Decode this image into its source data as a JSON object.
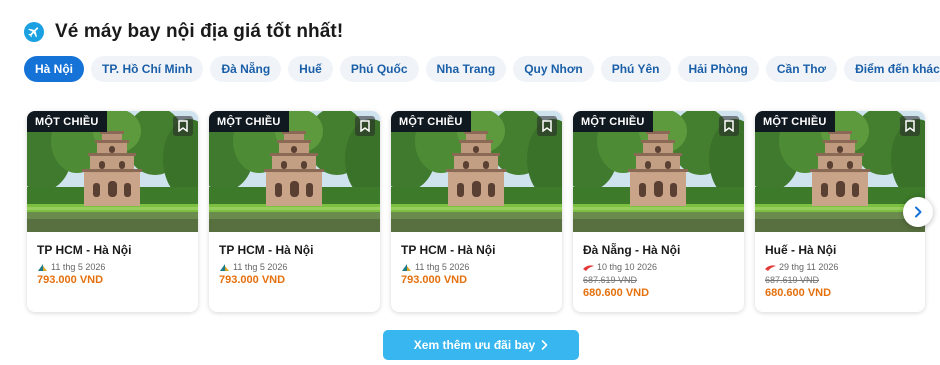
{
  "section": {
    "title": "Vé máy bay nội địa giá tốt nhất!"
  },
  "tabs": [
    "Hà Nội",
    "TP. Hồ Chí Minh",
    "Đà Nẵng",
    "Huế",
    "Phú Quốc",
    "Nha Trang",
    "Quy Nhơn",
    "Phú Yên",
    "Hải Phòng",
    "Cần Thơ",
    "Điểm đến khác"
  ],
  "active_tab": "Hà Nội",
  "cards": [
    {
      "badge": "MỘT CHIỀU",
      "route": "TP HCM - Hà Nội",
      "date": "11 thg 5 2026",
      "airline_icon": "vietnam-airlines-icon",
      "old_price": "",
      "price": "793.000 VND"
    },
    {
      "badge": "MỘT CHIỀU",
      "route": "TP HCM - Hà Nội",
      "date": "11 thg 5 2026",
      "airline_icon": "vietnam-airlines-icon",
      "old_price": "",
      "price": "793.000 VND"
    },
    {
      "badge": "MỘT CHIỀU",
      "route": "TP HCM - Hà Nội",
      "date": "11 thg 5 2026",
      "airline_icon": "vietnam-airlines-icon",
      "old_price": "",
      "price": "793.000 VND"
    },
    {
      "badge": "MỘT CHIỀU",
      "route": "Đà Nẵng - Hà Nội",
      "date": "10 thg 10 2026",
      "airline_icon": "vietjet-icon",
      "old_price": "687.619 VND",
      "price": "680.600 VND"
    },
    {
      "badge": "MỘT CHIỀU",
      "route": "Huế - Hà Nội",
      "date": "29 thg 11 2026",
      "airline_icon": "vietjet-icon",
      "old_price": "687.619 VND",
      "price": "680.600 VND"
    }
  ],
  "more_button": {
    "label": "Xem thêm ưu đãi bay"
  },
  "icons": {
    "header": "plane-icon",
    "bookmark": "bookmark-icon",
    "next": "chevron-right-icon",
    "more": "chevron-right-icon"
  },
  "colors": {
    "primary": "#1573d8",
    "tab_bg": "#f0f4f9",
    "tab_text": "#1b5fa8",
    "price": "#e5700e",
    "cta": "#37b6ef",
    "badge": "#101820"
  }
}
